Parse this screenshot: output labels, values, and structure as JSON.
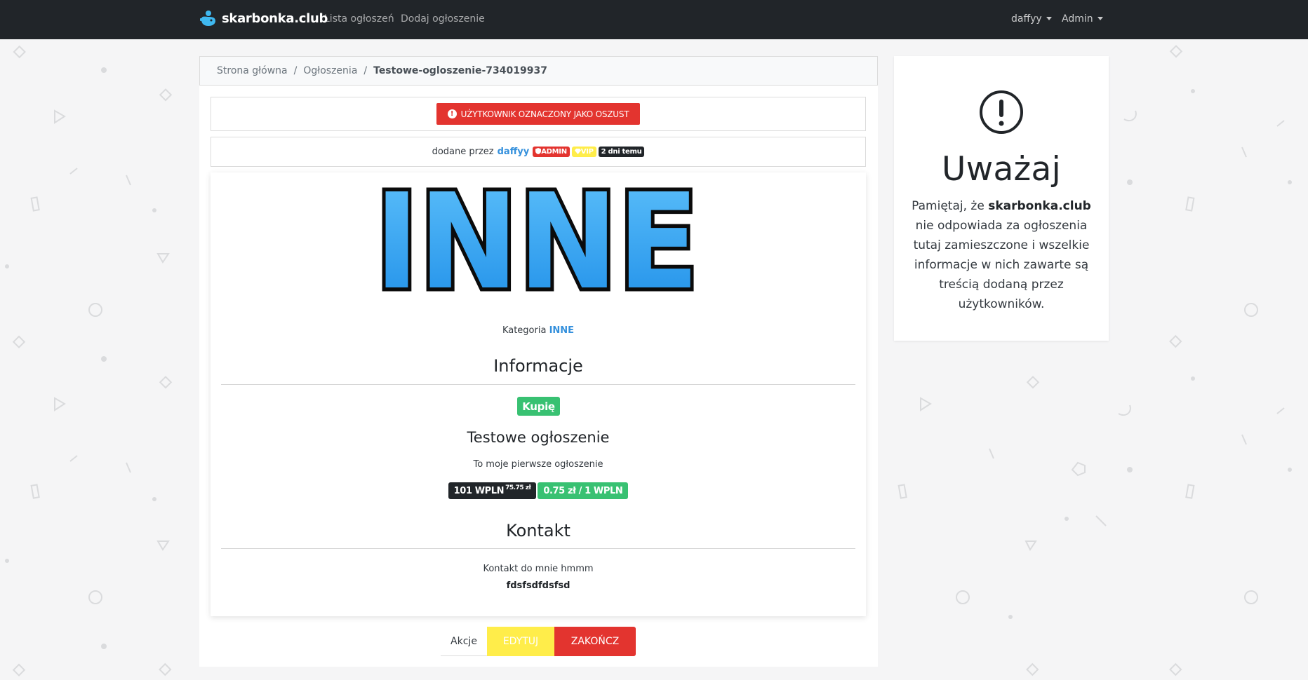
{
  "navbar": {
    "brand": "skarbonka.club",
    "links": [
      "Lista ogłoszeń",
      "Dodaj ogłoszenie"
    ],
    "user_menu": "daffyy",
    "admin_menu": "Admin"
  },
  "breadcrumb": {
    "home": "Strona główna",
    "section": "Ogłoszenia",
    "current": "Testowe-ogloszenie-734019937"
  },
  "alert": {
    "scam_label": "UŻYTKOWNIK OZNACZONY JAKO OSZUST",
    "icon": "exclamation-circle-icon"
  },
  "author": {
    "prefix": "dodane przez",
    "username": "daffyy",
    "admin_badge": "ADMIN",
    "vip_badge": "VIP",
    "time_badge": "2 dni temu"
  },
  "listing": {
    "category_logo_text": "INNE",
    "category_prefix": "Kategoria",
    "category": "INNE",
    "info_heading": "Informacje",
    "type": "Kupię",
    "title": "Testowe ogłoszenie",
    "description": "To moje pierwsze ogłoszenie",
    "price": "101 WPLN",
    "price_sub": "75.75 zł",
    "rate": "0.75 zł / 1 WPLN",
    "contact_heading": "Kontakt",
    "contact_text": "Kontakt do mnie hmmm",
    "contact_value": "fdsfsdfdsfsd"
  },
  "actions": {
    "label": "Akcje",
    "edit": "EDYTUJ",
    "end": "ZAKOŃCZ"
  },
  "warning": {
    "icon": "exclamation-circle-icon",
    "title": "Uważaj",
    "text_before": "Pamiętaj, że ",
    "site": "skarbonka.club",
    "text_after": " nie odpowiada za ogłoszenia tutaj zamieszczone i wszelkie informacje w nich zawarte są treścią dodaną przez użytkowników."
  },
  "colors": {
    "navbar": "#212529",
    "danger": "#e3342f",
    "warning": "#ffed4a",
    "success": "#38c172",
    "link": "#3490dc"
  }
}
